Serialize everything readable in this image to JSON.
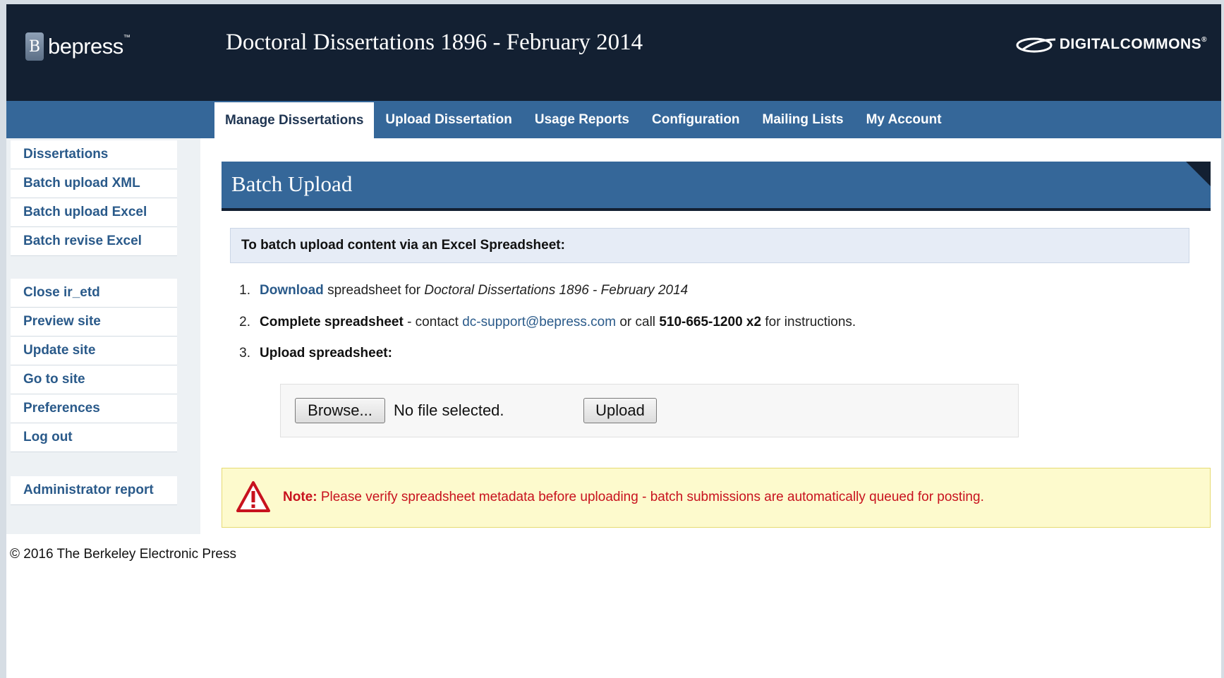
{
  "header": {
    "logo_text": "bepress",
    "logo_badge": "B",
    "logo_tm": "™",
    "site_title": "Doctoral Dissertations 1896 - February 2014",
    "dc_logo_text": "DIGITALCOMMONS",
    "dc_reg": "®"
  },
  "nav": {
    "tabs": [
      {
        "label": "Manage Dissertations",
        "active": true
      },
      {
        "label": "Upload Dissertation"
      },
      {
        "label": "Usage Reports"
      },
      {
        "label": "Configuration"
      },
      {
        "label": "Mailing Lists"
      },
      {
        "label": "My Account"
      }
    ]
  },
  "sidebar": {
    "group1": [
      "Dissertations",
      "Batch upload XML",
      "Batch upload Excel",
      "Batch revise Excel"
    ],
    "group2": [
      "Close ir_etd",
      "Preview site",
      "Update site",
      "Go to site",
      "Preferences",
      "Log out"
    ],
    "group3": [
      "Administrator report"
    ]
  },
  "main": {
    "heading": "Batch Upload",
    "instructions": "To batch upload content via an Excel Spreadsheet:",
    "step1": {
      "num": "1.",
      "link": "Download",
      "text": "spreadsheet for",
      "title": "Doctoral Dissertations 1896 - February 2014"
    },
    "step2": {
      "num": "2.",
      "bold": "Complete spreadsheet",
      "text1": "- contact",
      "email": "dc-support@bepress.com",
      "text2": "or call",
      "phone": "510-665-1200 x2",
      "text3": "for instructions."
    },
    "step3": {
      "num": "3.",
      "bold": "Upload spreadsheet:"
    },
    "upload": {
      "browse_label": "Browse...",
      "file_status": "No file selected.",
      "upload_label": "Upload"
    },
    "note": {
      "label": "Note:",
      "text": "Please verify spreadsheet metadata before uploading - batch submissions are automatically queued for posting."
    }
  },
  "footer": {
    "text": "© 2016 The Berkeley Electronic Press"
  },
  "colors": {
    "header_bg": "#132032",
    "nav_bg": "#356799",
    "link": "#2a5a8a",
    "warning_text": "#c8121e",
    "note_bg": "#fdfacd"
  }
}
